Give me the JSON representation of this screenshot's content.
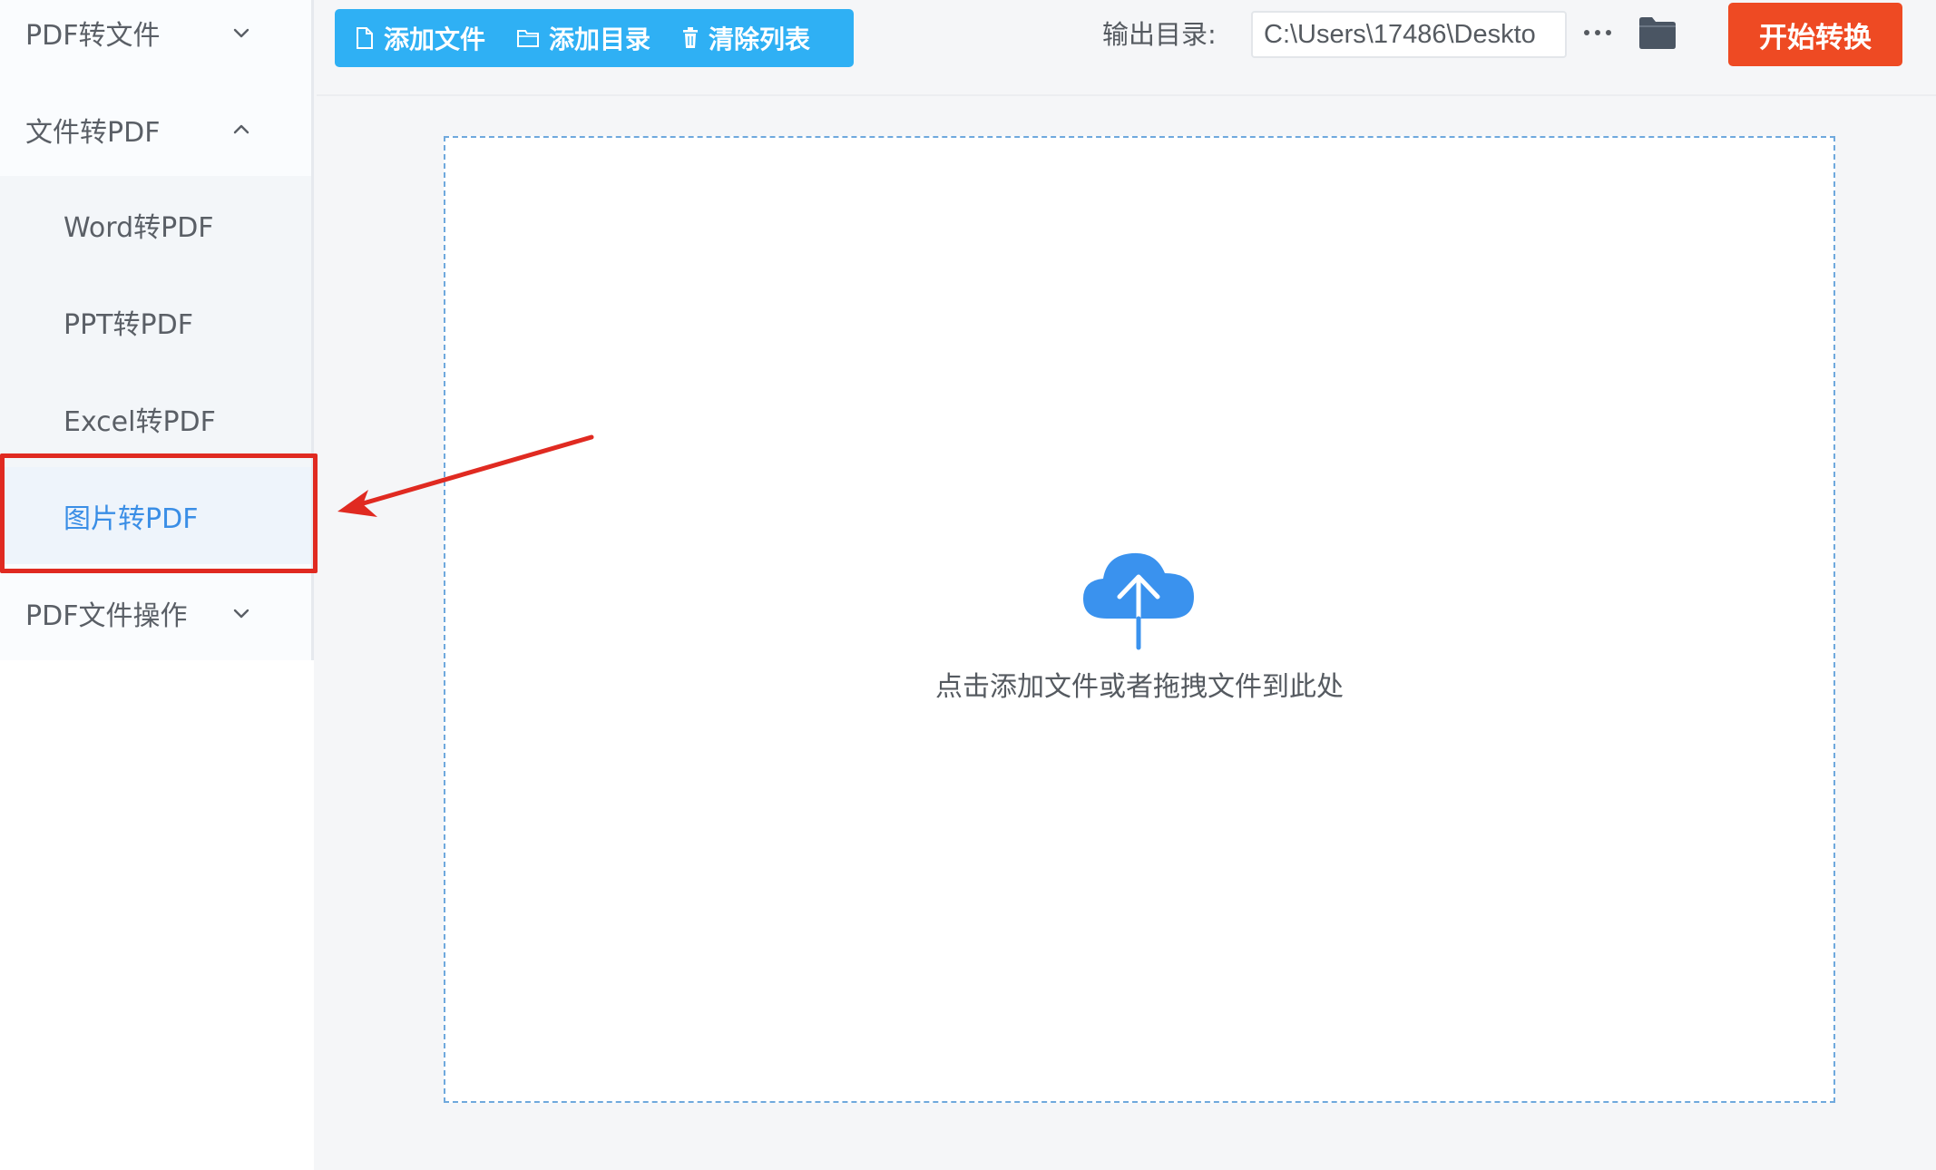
{
  "sidebar": {
    "groups": [
      {
        "label": "PDF转文件",
        "expanded": false
      },
      {
        "label": "文件转PDF",
        "expanded": true
      },
      {
        "label": "PDF文件操作",
        "expanded": false
      }
    ],
    "items": [
      {
        "label": "Word转PDF",
        "active": false
      },
      {
        "label": "PPT转PDF",
        "active": false
      },
      {
        "label": "Excel转PDF",
        "active": false
      },
      {
        "label": "图片转PDF",
        "active": true
      }
    ]
  },
  "toolbar": {
    "add_file_label": "添加文件",
    "add_folder_label": "添加目录",
    "clear_list_label": "清除列表",
    "output_label": "输出目录:",
    "output_path": "C:\\Users\\17486\\Deskto",
    "start_label": "开始转换"
  },
  "drop_zone": {
    "hint": "点击添加文件或者拖拽文件到此处"
  },
  "colors": {
    "toolbar_blue": "#2fb0f4",
    "start_red": "#ee4a23",
    "active_blue": "#3a8ee6",
    "annotation_red": "#e02a21",
    "cloud_blue": "#3a92ee"
  },
  "icons": {
    "add_file": "file-icon",
    "add_folder": "folder-outline-icon",
    "clear_list": "trash-icon",
    "more": "ellipsis-icon",
    "browse": "folder-icon",
    "upload": "cloud-upload-icon",
    "group_collapsed": "chevron-down-icon",
    "group_expanded": "chevron-up-icon"
  }
}
